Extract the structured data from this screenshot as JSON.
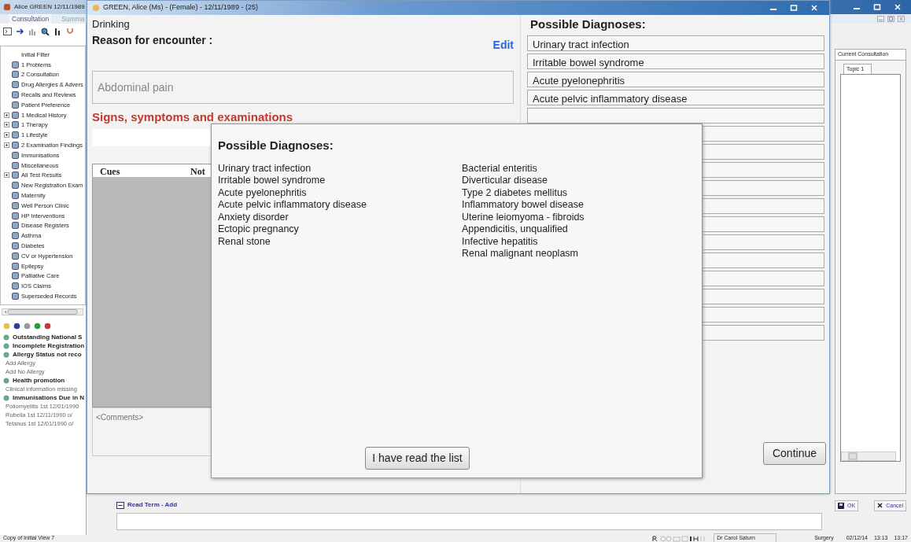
{
  "app": {
    "title": "Alice GREEN 12/11/1989",
    "tabs": [
      {
        "label": "Consultation",
        "selected": true
      },
      {
        "label": "Summa",
        "selected": false
      }
    ]
  },
  "tree": [
    {
      "label": "Initial Filter",
      "kind": "root",
      "children": [
        {
          "label": "1 Problems",
          "kind": "leaf"
        },
        {
          "label": "2 Consultation",
          "kind": "leaf"
        },
        {
          "label": "Drug Allergies & Advers",
          "kind": "leaf"
        },
        {
          "label": "Recalls and Reviews",
          "kind": "leaf"
        },
        {
          "label": "Patient Preference",
          "kind": "leaf"
        },
        {
          "label": "1 Medical History",
          "kind": "folder"
        },
        {
          "label": "1 Therapy",
          "kind": "folder"
        },
        {
          "label": "1 Lifestyle",
          "kind": "folder"
        },
        {
          "label": "2 Examination Findings",
          "kind": "folder"
        },
        {
          "label": "Immunisations",
          "kind": "leaf"
        },
        {
          "label": "Miscellaneous",
          "kind": "leaf"
        },
        {
          "label": "All Test Results",
          "kind": "folder"
        },
        {
          "label": "New Registration Exam",
          "kind": "leaf"
        },
        {
          "label": "Maternity",
          "kind": "leaf"
        },
        {
          "label": "Well Person Clinic",
          "kind": "leaf"
        },
        {
          "label": "HP Interventions",
          "kind": "leaf"
        },
        {
          "label": "Disease Registers",
          "kind": "leaf"
        },
        {
          "label": "Asthma",
          "kind": "leaf"
        },
        {
          "label": "Diabetes",
          "kind": "leaf"
        },
        {
          "label": "CV or Hypertension",
          "kind": "leaf"
        },
        {
          "label": "Epilepsy",
          "kind": "leaf"
        },
        {
          "label": "Palliative Care",
          "kind": "leaf"
        },
        {
          "label": "IOS Claims",
          "kind": "leaf"
        },
        {
          "label": "Superseded Records",
          "kind": "leaf"
        }
      ]
    }
  ],
  "alerts": [
    {
      "kind": "heading",
      "text": "Outstanding National S"
    },
    {
      "kind": "heading",
      "text": "Incomplete Registration"
    },
    {
      "kind": "heading",
      "text": "Allergy Status not reco"
    },
    {
      "kind": "detail",
      "text": "Add Allergy"
    },
    {
      "kind": "detail",
      "text": "Add No Allergy"
    },
    {
      "kind": "heading",
      "text": "Health promotion"
    },
    {
      "kind": "detail",
      "text": "Clinical information missing"
    },
    {
      "kind": "heading",
      "text": "Immunisations Due in N"
    },
    {
      "kind": "detail",
      "text": "Poliomyelitis 1st 12/01/1990"
    },
    {
      "kind": "detail",
      "text": "Rubella 1st 12/11/1990 o/"
    },
    {
      "kind": "detail",
      "text": "Tetanus 1st 12/01/1990 o/"
    }
  ],
  "dialog": {
    "title": "GREEN, Alice (Ms) - (Female) - 12/11/1989 - (25)",
    "context": "Drinking",
    "reason_label": "Reason for encounter :",
    "edit_link": "Edit",
    "reason_value": "Abdominal pain",
    "signs_heading": "Signs, symptoms and examinations",
    "cues_columns": [
      "Cues",
      "Not"
    ],
    "comments_placeholder": "<Comments>",
    "diagnoses_heading": "Possible Diagnoses:",
    "diagnoses": [
      {
        "kind": "entry",
        "text": "Urinary tract infection"
      },
      {
        "kind": "entry",
        "text": "Irritable bowel syndrome"
      },
      {
        "kind": "entry",
        "text": "Acute pyelonephritis"
      },
      {
        "kind": "entry",
        "text": "Acute pelvic inflammatory disease"
      },
      {
        "kind": "blank"
      },
      {
        "kind": "blank"
      },
      {
        "kind": "blank"
      },
      {
        "kind": "blank"
      },
      {
        "kind": "blank"
      },
      {
        "kind": "blank"
      },
      {
        "kind": "blank"
      },
      {
        "kind": "blank"
      },
      {
        "kind": "blank"
      },
      {
        "kind": "blank"
      },
      {
        "kind": "blank"
      },
      {
        "kind": "blank"
      },
      {
        "kind": "blank"
      }
    ],
    "continue_button": "Continue"
  },
  "popup": {
    "title": "Possible Diagnoses:",
    "columns": [
      [
        "Urinary tract infection",
        "Irritable bowel syndrome",
        "Acute pyelonephritis",
        "Acute pelvic inflammatory disease",
        "Anxiety disorder",
        "Ectopic pregnancy",
        "Renal stone"
      ],
      [
        "Bacterial enteritis",
        "Diverticular disease",
        "Type 2 diabetes mellitus",
        "Inflammatory bowel disease",
        "Uterine leiomyoma - fibroids",
        "Appendicitis, unqualified",
        "Infective hepatitis",
        "Renal malignant neoplasm"
      ]
    ],
    "button": "I have read the list"
  },
  "read_term": {
    "label": "Read Term - Add"
  },
  "right_panel": {
    "tab": "Current Consultation",
    "topic_tab": "Topic 1",
    "ok": "OK",
    "cancel": "Cancel"
  },
  "status_bar": {
    "text": "Copy of Initial View 7",
    "user": "Dr Carol Saturn",
    "location": "Surgery",
    "date": "02/12/14",
    "times": [
      "13:13",
      "13:17"
    ]
  }
}
